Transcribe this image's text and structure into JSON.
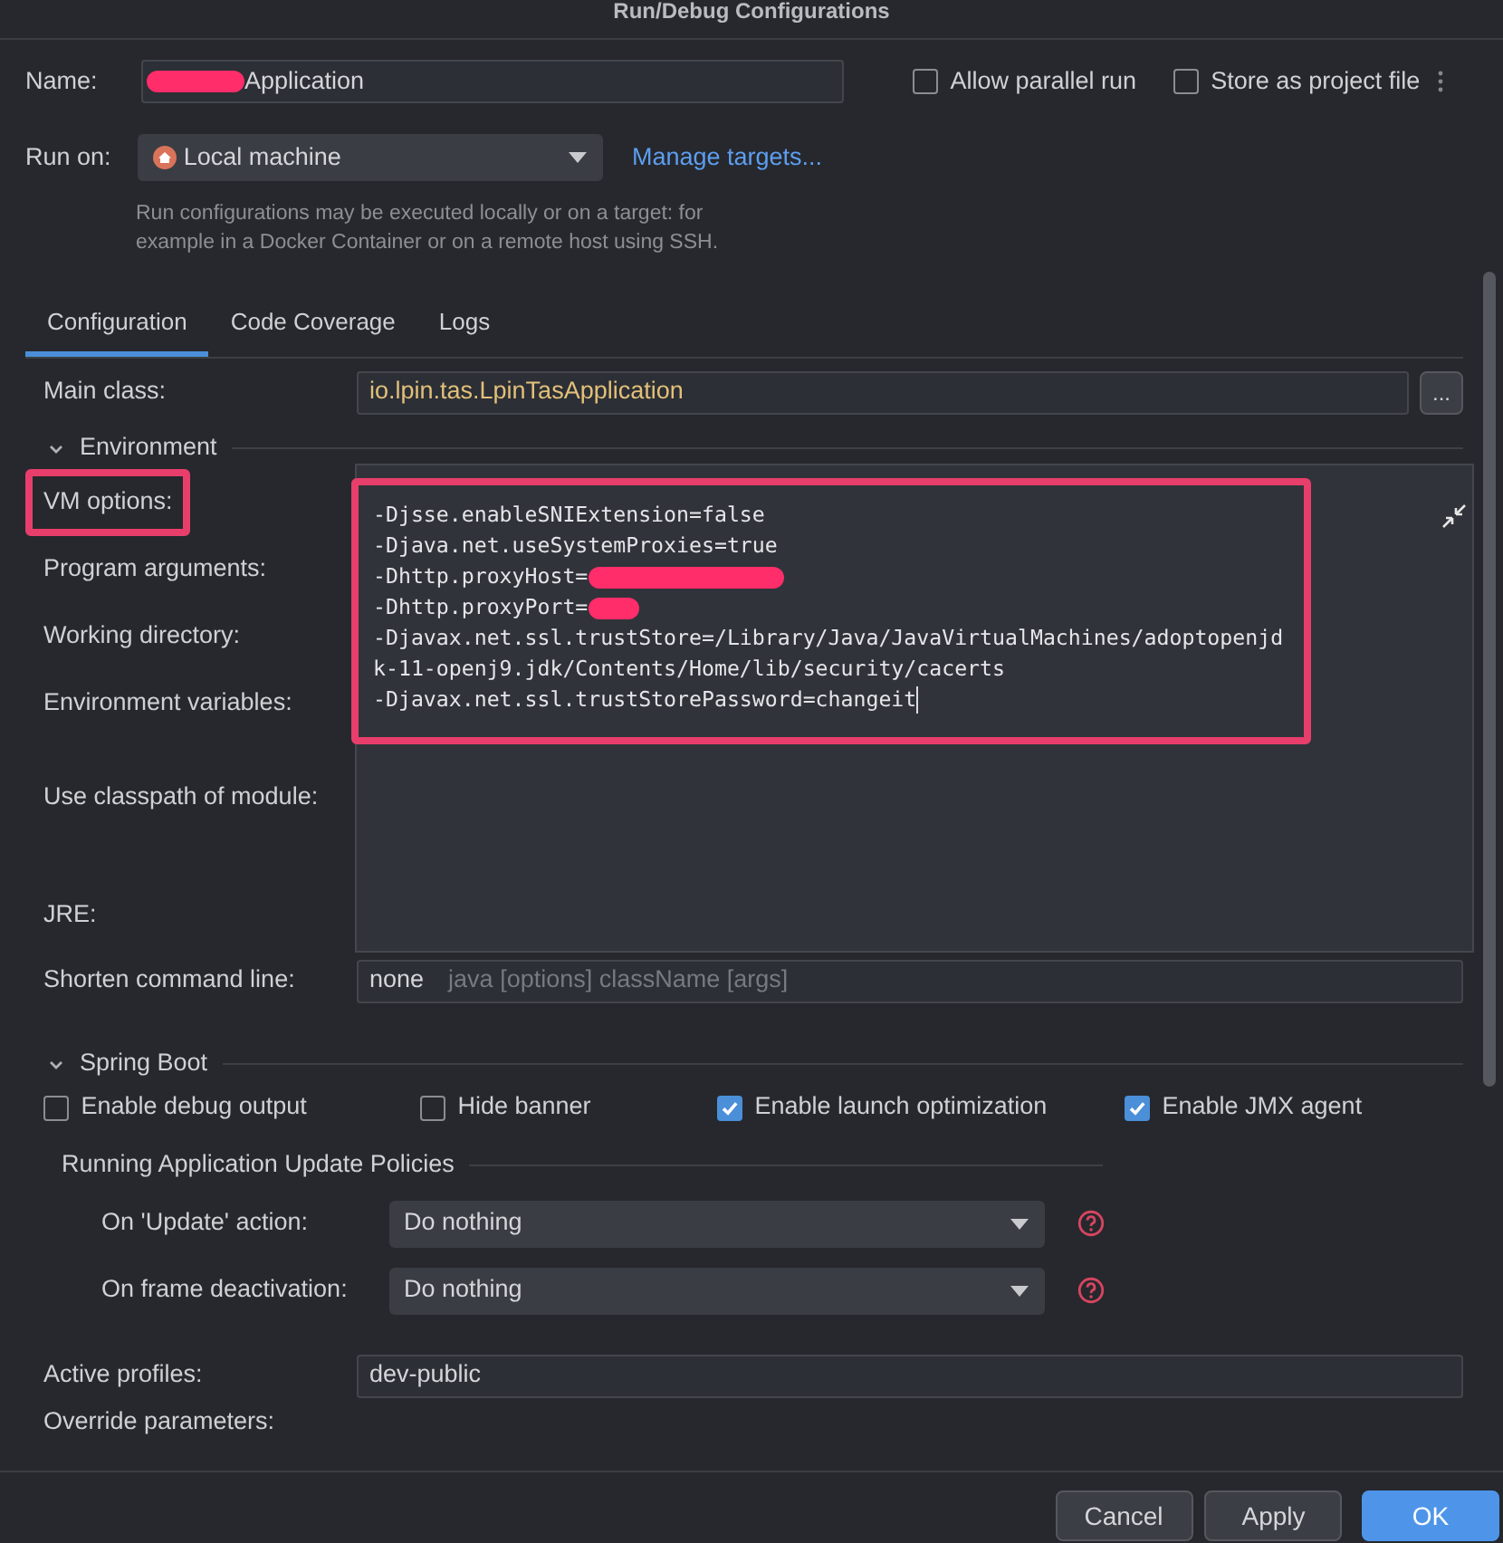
{
  "window": {
    "title": "Run/Debug Configurations"
  },
  "name": {
    "label": "Name:",
    "value": "Application",
    "redacted": true
  },
  "top_options": [
    {
      "label": "Allow parallel run",
      "checked": false
    },
    {
      "label": "Store as project file",
      "checked": false
    }
  ],
  "run_on": {
    "label": "Run on:",
    "value": "Local machine",
    "link": "Manage targets...",
    "hint_lines": [
      "Run configurations may be executed locally or on a target: for",
      "example in a Docker Container or on a remote host using SSH."
    ]
  },
  "tabs": [
    {
      "label": "Configuration",
      "selected": true
    },
    {
      "label": "Code Coverage",
      "selected": false
    },
    {
      "label": "Logs",
      "selected": false
    }
  ],
  "main_class": {
    "label": "Main class:",
    "value": "io.lpin.tas.LpinTasApplication",
    "button": "..."
  },
  "environment": {
    "title": "Environment",
    "expanded": true,
    "labels": [
      {
        "text": "VM options:",
        "highlighted": true
      },
      {
        "text": "Program arguments:",
        "highlighted": false
      },
      {
        "text": "Working directory:",
        "highlighted": false
      },
      {
        "text": "Environment variables:",
        "highlighted": false
      },
      {
        "text": "Use classpath of module:",
        "highlighted": false
      },
      {
        "text": "JRE:",
        "highlighted": false
      }
    ],
    "vm_options": {
      "highlighted": true,
      "lines": [
        {
          "text": "-Djsse.enableSNIExtension=false",
          "redacted": false
        },
        {
          "text": "-Djava.net.useSystemProxies=true",
          "redacted": false
        },
        {
          "text": "-Dhttp.proxyHost=",
          "redacted": true
        },
        {
          "text": "-Dhttp.proxyPort=",
          "redacted": true
        },
        {
          "text": "-Djavax.net.ssl.trustStore=/Library/Java/JavaVirtualMachines/adoptopenjd",
          "redacted": false
        },
        {
          "text": "k-11-openj9.jdk/Contents/Home/lib/security/cacerts",
          "redacted": false
        },
        {
          "text": "-Djavax.net.ssl.trustStorePassword=changeit",
          "redacted": false
        }
      ]
    },
    "shorten": {
      "label": "Shorten command line:",
      "value": "none",
      "hint": "java [options] className [args]"
    }
  },
  "spring_boot": {
    "title": "Spring Boot",
    "expanded": true,
    "checkboxes": [
      {
        "label": "Enable debug output",
        "checked": false
      },
      {
        "label": "Hide banner",
        "checked": false
      },
      {
        "label": "Enable launch optimization",
        "checked": true
      },
      {
        "label": "Enable JMX agent",
        "checked": true
      }
    ],
    "policies": {
      "title": "Running Application Update Policies",
      "rows": [
        {
          "label": "On 'Update' action:",
          "value": "Do nothing"
        },
        {
          "label": "On frame deactivation:",
          "value": "Do nothing"
        }
      ]
    },
    "active_profiles": {
      "label": "Active profiles:",
      "value": "dev-public"
    },
    "override_label": "Override parameters:"
  },
  "buttons": [
    {
      "label": "Cancel",
      "primary": false
    },
    {
      "label": "Apply",
      "primary": false
    },
    {
      "label": "OK",
      "primary": true
    }
  ]
}
